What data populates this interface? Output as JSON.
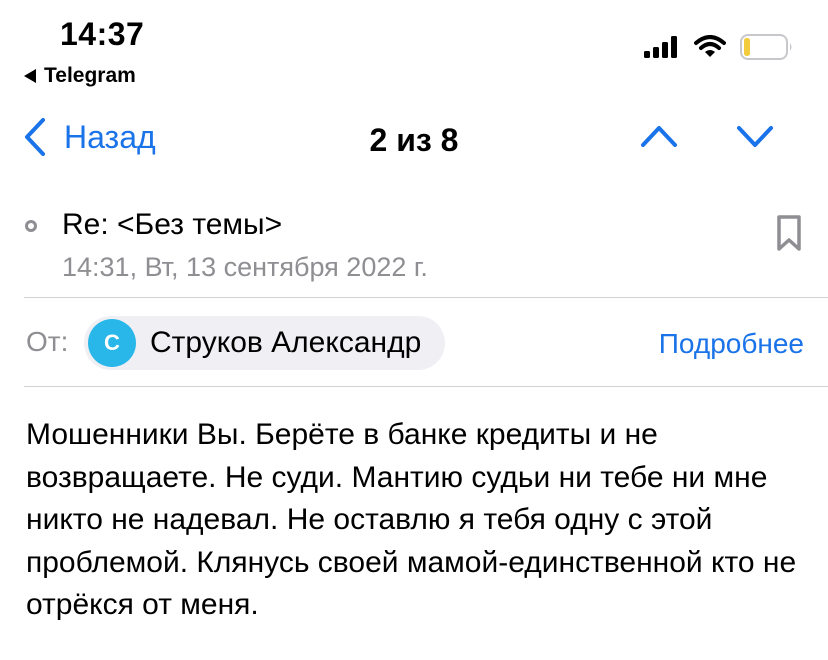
{
  "status_bar": {
    "time": "14:37",
    "back_app": "Telegram",
    "icons": [
      "signal-icon",
      "wifi-icon",
      "battery-icon"
    ],
    "battery_color": "#f2cc3d"
  },
  "nav": {
    "back_label": "Назад",
    "counter": "2 из 8",
    "accent_color": "#1a73e8"
  },
  "message": {
    "subject": "Re: <Без темы>",
    "date": "14:31, Вт, 13 сентября 2022 г.",
    "from_label": "От:",
    "sender_initial": "С",
    "sender_name": "Струков Александр",
    "details_label": "Подробнее",
    "body": "Мошенники Вы. Берёте в банке кредиты и не возвращаете. Не суди. Мантию судьи ни тебе ни мне никто не надевал. Не оставлю я тебя одну с этой проблемой. Клянусь своей мамой-единственной кто не отрёкся от меня."
  }
}
